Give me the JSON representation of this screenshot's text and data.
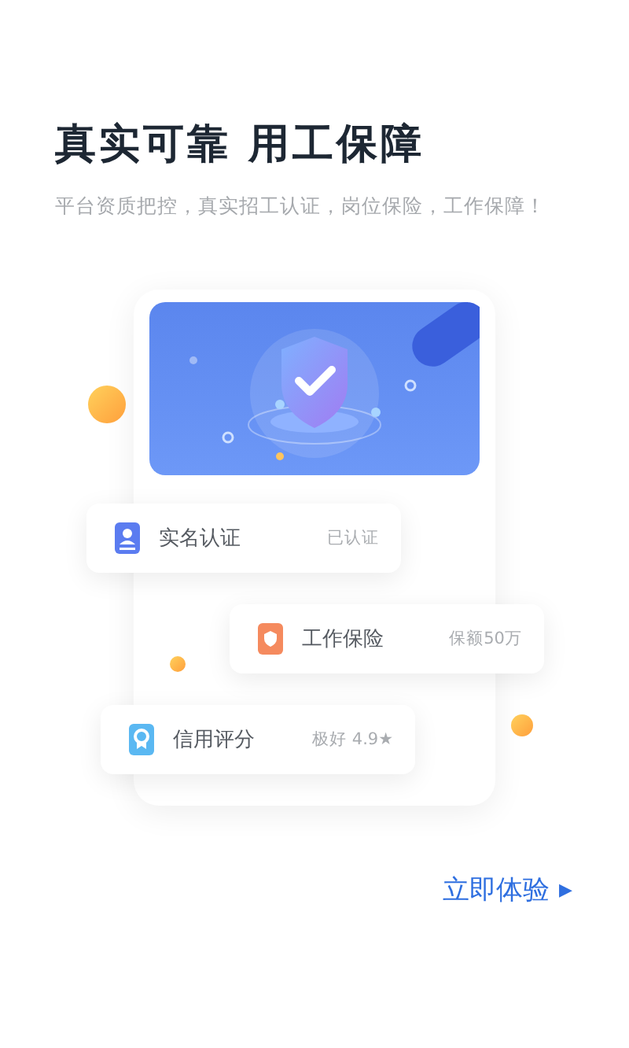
{
  "title": "真实可靠 用工保障",
  "subtitle": "平台资质把控，真实招工认证，岗位保险，工作保障！",
  "features": [
    {
      "kind": "identity",
      "label": "实名认证",
      "value": "已认证"
    },
    {
      "kind": "insurance",
      "label": "工作保险",
      "value": "保额50万"
    },
    {
      "kind": "credit",
      "label": "信用评分",
      "value": "极好 4.9★"
    }
  ],
  "action": {
    "label": "立即体验",
    "arrow": "▶"
  }
}
